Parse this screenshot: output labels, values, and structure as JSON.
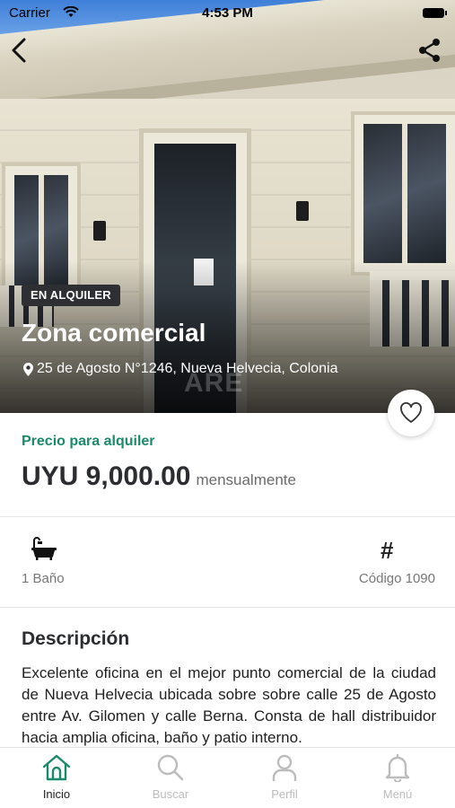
{
  "status_bar": {
    "carrier": "Carrier",
    "time": "4:53 PM"
  },
  "listing": {
    "badge": "EN ALQUILER",
    "title": "Zona comercial",
    "address": "25 de Agosto N°1246, Nueva Helvecia, Colonia",
    "watermark": "ARE",
    "favorited": false
  },
  "price": {
    "label": "Precio para alquiler",
    "amount": "UYU 9,000.00",
    "period": "mensualmente"
  },
  "features": {
    "bathrooms": "1 Baño",
    "code": "Código 1090"
  },
  "description": {
    "title": "Descripción",
    "body": "Excelente oficina en el mejor punto comercial de la ciudad de Nueva Helvecia ubicada sobre sobre calle 25 de Agosto entre Av. Gilomen  y calle Berna. Consta de hall distribuidor hacia amplia oficina, baño y patio interno."
  },
  "tabbar": {
    "items": [
      {
        "label": "Inicio",
        "icon": "home-icon",
        "active": true
      },
      {
        "label": "Buscar",
        "icon": "search-icon",
        "active": false
      },
      {
        "label": "Perfil",
        "icon": "user-icon",
        "active": false
      },
      {
        "label": "Menú",
        "icon": "bell-icon",
        "active": false
      }
    ]
  },
  "colors": {
    "accent": "#1a8a6b",
    "badge_bg": "#2d2f33",
    "inactive": "#bcbcbc"
  }
}
